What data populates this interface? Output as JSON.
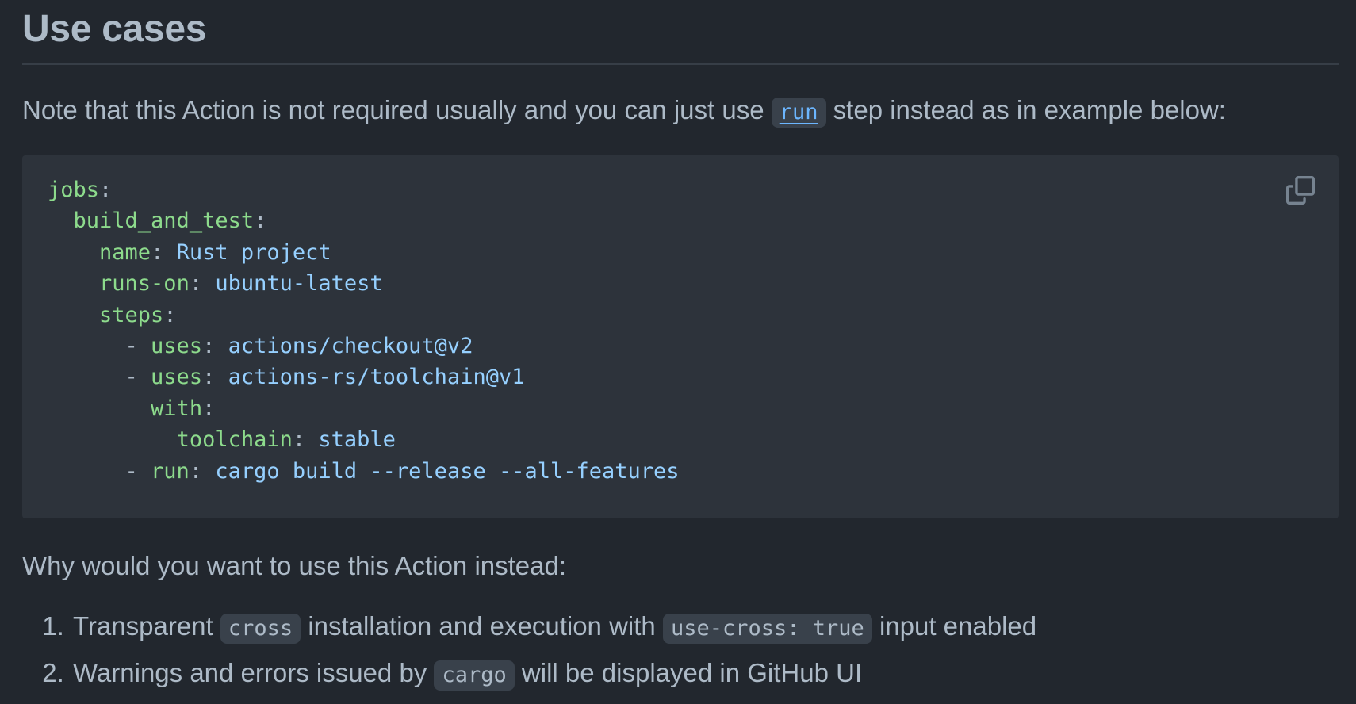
{
  "heading": "Use cases",
  "intro": {
    "before": "Note that this Action is not required usually and you can just use ",
    "link_code": "run",
    "after": " step instead as in example below:"
  },
  "code_block": {
    "lines": [
      [
        {
          "t": "jobs",
          "c": "k"
        },
        {
          "t": ":",
          "c": "p"
        }
      ],
      [
        {
          "t": "  ",
          "c": "p"
        },
        {
          "t": "build_and_test",
          "c": "k"
        },
        {
          "t": ":",
          "c": "p"
        }
      ],
      [
        {
          "t": "    ",
          "c": "p"
        },
        {
          "t": "name",
          "c": "k"
        },
        {
          "t": ": ",
          "c": "p"
        },
        {
          "t": "Rust project",
          "c": "s"
        }
      ],
      [
        {
          "t": "    ",
          "c": "p"
        },
        {
          "t": "runs-on",
          "c": "k"
        },
        {
          "t": ": ",
          "c": "p"
        },
        {
          "t": "ubuntu-latest",
          "c": "s"
        }
      ],
      [
        {
          "t": "    ",
          "c": "p"
        },
        {
          "t": "steps",
          "c": "k"
        },
        {
          "t": ":",
          "c": "p"
        }
      ],
      [
        {
          "t": "      - ",
          "c": "p"
        },
        {
          "t": "uses",
          "c": "k"
        },
        {
          "t": ": ",
          "c": "p"
        },
        {
          "t": "actions/checkout@v2",
          "c": "s"
        }
      ],
      [
        {
          "t": "      - ",
          "c": "p"
        },
        {
          "t": "uses",
          "c": "k"
        },
        {
          "t": ": ",
          "c": "p"
        },
        {
          "t": "actions-rs/toolchain@v1",
          "c": "s"
        }
      ],
      [
        {
          "t": "        ",
          "c": "p"
        },
        {
          "t": "with",
          "c": "k"
        },
        {
          "t": ":",
          "c": "p"
        }
      ],
      [
        {
          "t": "          ",
          "c": "p"
        },
        {
          "t": "toolchain",
          "c": "k"
        },
        {
          "t": ": ",
          "c": "p"
        },
        {
          "t": "stable",
          "c": "s"
        }
      ],
      [
        {
          "t": "      - ",
          "c": "p"
        },
        {
          "t": "run",
          "c": "k"
        },
        {
          "t": ": ",
          "c": "p"
        },
        {
          "t": "cargo build --release --all-features",
          "c": "s"
        }
      ]
    ],
    "copy_icon": "copy-icon"
  },
  "why_text": "Why would you want to use this Action instead:",
  "reasons": [
    {
      "before": "Transparent ",
      "code1": "cross",
      "middle": " installation and execution with ",
      "code2": "use-cross: true",
      "after": " input enabled"
    },
    {
      "before": "Warnings and errors issued by ",
      "code1": "cargo",
      "after": " will be displayed in GitHub UI"
    }
  ],
  "colors": {
    "background": "#22272e",
    "code_background": "#2d333b",
    "key": "#8ddb8c",
    "string": "#96d0ff",
    "link": "#6cb6ff",
    "text": "#adbac7"
  }
}
